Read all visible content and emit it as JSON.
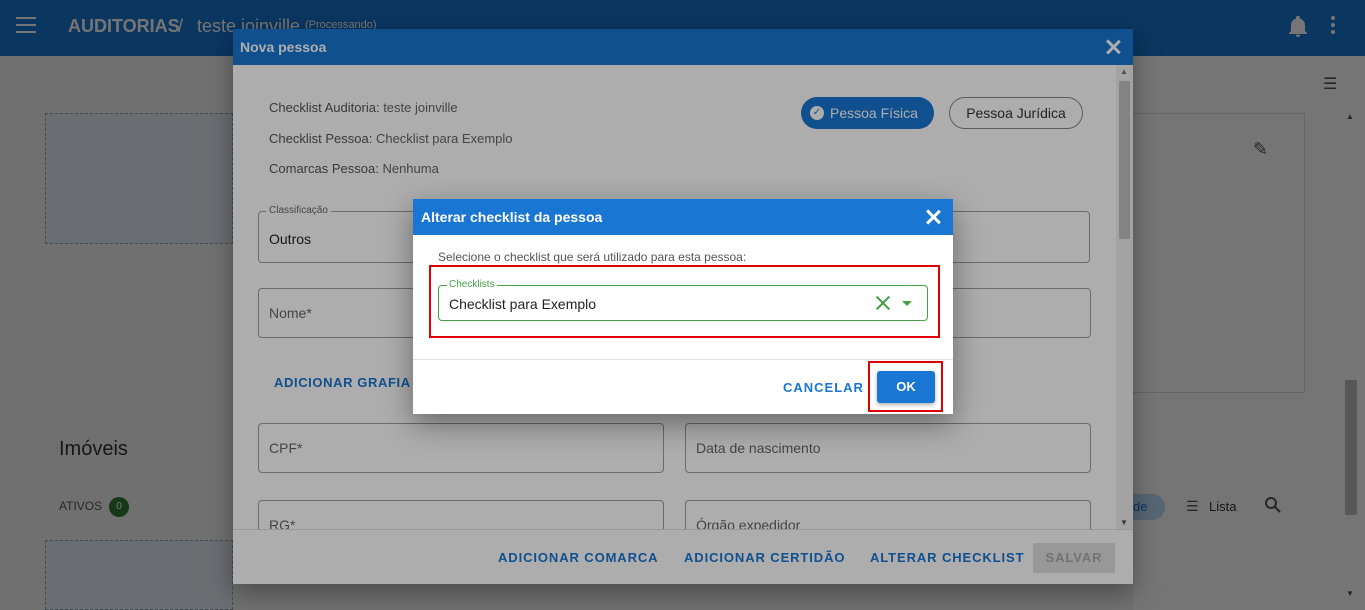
{
  "app_bar": {
    "title": "AUDITORIAS",
    "separator": "/",
    "subtitle": "teste joinville",
    "status": "(Processando)"
  },
  "background": {
    "section_title": "Imóveis",
    "ativos_label": "ATIVOS",
    "ativos_count": "0",
    "view_chip": "de",
    "lista_label": "Lista"
  },
  "nova_pessoa": {
    "title": "Nova pessoa",
    "info": [
      {
        "label": "Checklist Auditoria:",
        "value": "teste joinville"
      },
      {
        "label": "Checklist Pessoa:",
        "value": "Checklist para Exemplo"
      },
      {
        "label": "Comarcas Pessoa:",
        "value": "Nenhuma"
      }
    ],
    "toggle_pf": "Pessoa Física",
    "toggle_pj": "Pessoa Jurídica",
    "classificacao": {
      "legend": "Classificação",
      "value": "Outros"
    },
    "nome_placeholder": "Nome*",
    "adicionar_grafia": "ADICIONAR GRAFIA A",
    "cpf_placeholder": "CPF*",
    "nascimento_placeholder": "Data de nascimento",
    "rg_placeholder": "RG*",
    "orgao_placeholder": "Órgão expedidor",
    "footer": {
      "adicionar_comarca": "ADICIONAR COMARCA",
      "adicionar_certidao": "ADICIONAR CERTIDÃO",
      "alterar_checklist": "ALTERAR CHECKLIST",
      "salvar": "SALVAR"
    }
  },
  "alterar_checklist": {
    "title": "Alterar checklist da pessoa",
    "prompt": "Selecione o checklist que será utilizado para esta pessoa:",
    "select_legend": "Checklists",
    "select_value": "Checklist para Exemplo",
    "cancel_label": "CANCELAR",
    "ok_label": "OK"
  },
  "colors": {
    "primary": "#1976d2",
    "select_focus": "#43a047",
    "highlight": "#e00000"
  }
}
